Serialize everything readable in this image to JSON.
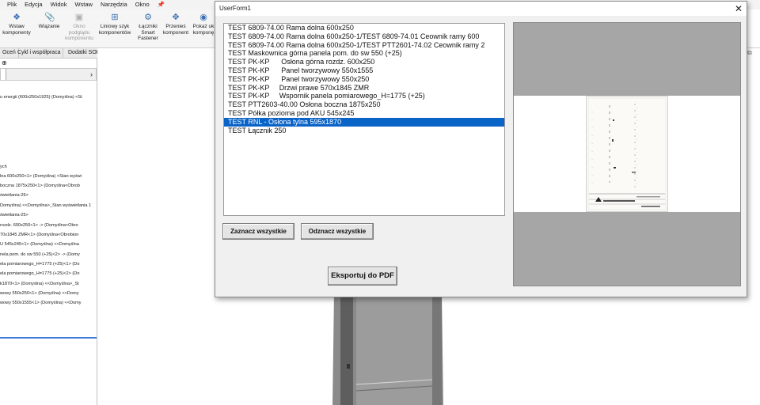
{
  "app": {
    "menu": [
      "Plik",
      "Edycja",
      "Widok",
      "Wstaw",
      "Narzędzia",
      "Okno"
    ],
    "ribbon_buttons": [
      {
        "label": "Wstaw komponenty",
        "icon": "insert-components-icon",
        "disabled": false
      },
      {
        "label": "Wiązanie",
        "icon": "mate-icon",
        "disabled": false
      },
      {
        "label": "Okno podglądu komponentu",
        "icon": "preview-window-icon",
        "disabled": true
      },
      {
        "label": "Liniowy szyk komponentów",
        "icon": "linear-pattern-icon",
        "disabled": false
      },
      {
        "label": "Łączniki Smart Fastener",
        "icon": "smart-fastener-icon",
        "disabled": false
      },
      {
        "label": "Przenieś komponent",
        "icon": "move-component-icon",
        "disabled": false
      },
      {
        "label": "Pokaż uk komponę",
        "icon": "show-hidden-icon",
        "disabled": false
      }
    ],
    "tabs": [
      "Oceń",
      "Cykl i współpraca",
      "Dodatki SOLIDWORKS"
    ],
    "tree_items": [
      "u energii (600x250x1925) (Domyślna) <St",
      "ych",
      "lna 600x250<1> (Domyślna) <Stan wyświ",
      "boczna 1875x250<1> (Domyślna<Obrob",
      "świetlania-26>",
      "Domyślna) <<Domyślna>_Stan wyświetlania 1",
      "świetlania-25>",
      " rozdz. 600x250<1> -> (Domyślna<Obro",
      "70x1845 ZMR<1> (Domyślna<Obrobion",
      "U 545x245<1> (Domyślna) <<Domyślna",
      "nela pom. do sw 550 (+25)<2> -> (Domy",
      "ela pomiarowego_H=1775 (+25)<1> (Do",
      "ela pomiarowego_H=1775 (+25)<2> (Do",
      "k1870<1> (Domyślna) <<Domyślna>_St",
      "wowy 550x250<1> (Domyślna) <<Domy",
      "wowy 550x1555<1> (Domyślna) <<Domy"
    ]
  },
  "dialog": {
    "title": "UserForm1",
    "list_items": [
      "TEST 6809-74.00 Rama dolna 600x250",
      "TEST 6809-74.00 Rama dolna 600x250-1/TEST 6809-74.01 Ceownik ramy 600",
      "TEST 6809-74.00 Rama dolna 600x250-1/TEST PTT2601-74.02 Ceownik ramy 2",
      "TEST Maskownica górna panela pom. do sw 550 (+25)",
      "TEST PK-KP      Osłona górna rozdz. 600x250",
      "TEST PK-KP      Panel tworzywowy 550x1555",
      "TEST PK-KP      Panel tworzywowy 550x250",
      "TEST PK-KP     Drzwi prawe 570x1845 ZMR",
      "TEST PK-KP     Wspornik panela pomiarowego_H=1775 (+25)",
      "TEST PTT2603-40.00 Osłona boczna 1875x250",
      "TEST Półka pozioma pod AKU 545x245",
      "TEST RNL - Osłona tylna 595x1870",
      "TEST Łącznik 250"
    ],
    "selected_index": 11,
    "select_all_label": "Zaznacz wszystkie",
    "deselect_all_label": "Odznacz wszystkie",
    "export_label": "Eksportuj do PDF",
    "close_icon": "close-icon"
  },
  "colors": {
    "selection": "#0a64c8",
    "dialog_bg": "#f0f0f0",
    "preview_bg": "#a6a6a6"
  }
}
